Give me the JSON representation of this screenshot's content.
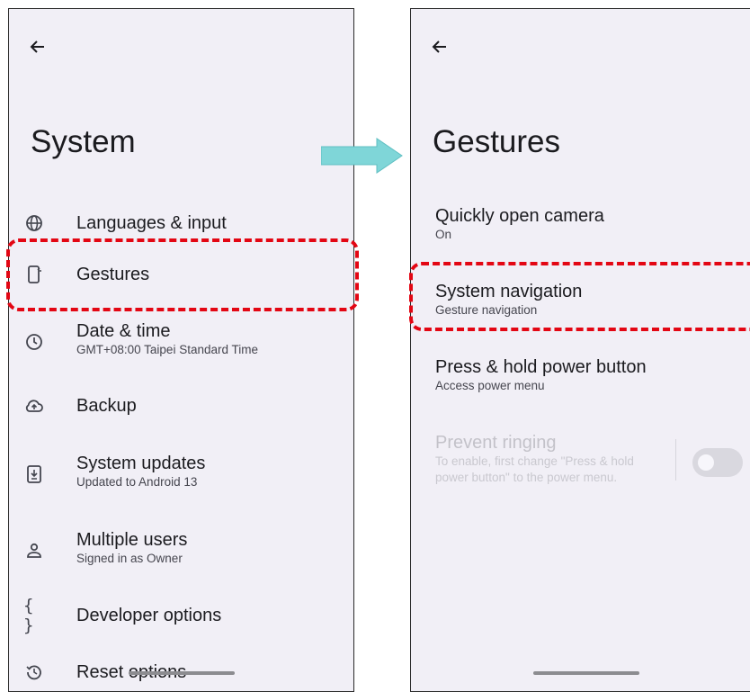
{
  "left_screen": {
    "title": "System",
    "items": [
      {
        "label": "Languages & input",
        "icon": "globe-icon"
      },
      {
        "label": "Gestures",
        "icon": "gestures-phone-icon"
      },
      {
        "label": "Date & time",
        "sub": "GMT+08:00 Taipei Standard Time",
        "icon": "clock-icon"
      },
      {
        "label": "Backup",
        "icon": "cloud-upload-icon"
      },
      {
        "label": "System updates",
        "sub": "Updated to Android 13",
        "icon": "system-update-icon"
      },
      {
        "label": "Multiple users",
        "sub": "Signed in as Owner",
        "icon": "person-icon"
      },
      {
        "label": "Developer options",
        "icon": "braces-icon"
      },
      {
        "label": "Reset options",
        "icon": "history-icon"
      }
    ]
  },
  "right_screen": {
    "title": "Gestures",
    "items": [
      {
        "label": "Quickly open camera",
        "sub": "On"
      },
      {
        "label": "System navigation",
        "sub": "Gesture navigation"
      },
      {
        "label": "Press & hold power button",
        "sub": "Access power menu"
      },
      {
        "label": "Prevent ringing",
        "sub_line1": "To enable, first change \"Press & hold",
        "sub_line2": "power button\" to the power menu.",
        "enabled": false,
        "toggle_on": false
      }
    ]
  },
  "colors": {
    "screen_bg": "#f1eff6",
    "highlight": "#e30613",
    "arrow": "#7fd6d8"
  }
}
